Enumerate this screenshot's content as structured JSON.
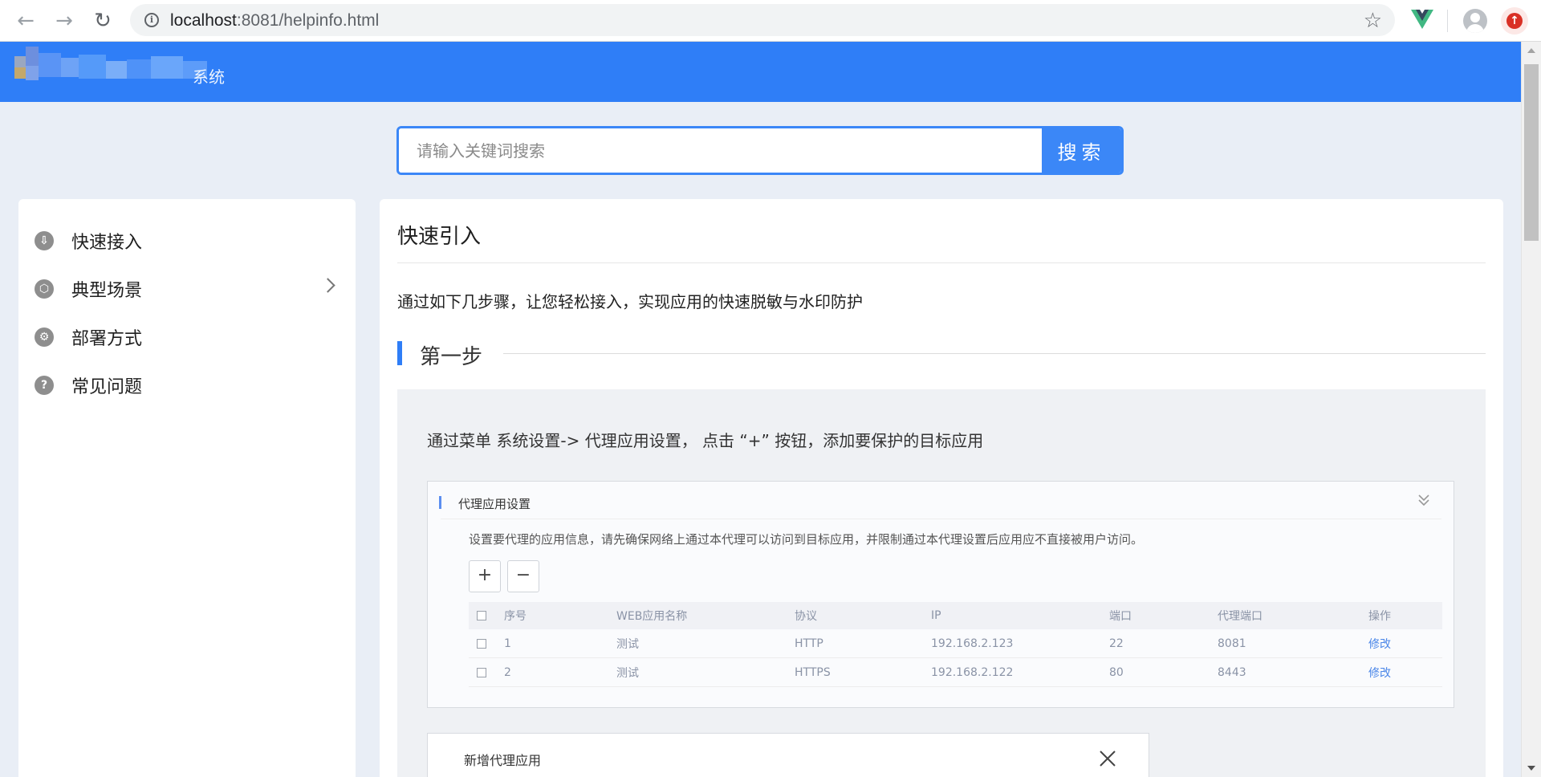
{
  "browser": {
    "url_host": "localhost",
    "url_rest": ":8081/helpinfo.html",
    "back_icon": "←",
    "forward_icon": "→",
    "reload_icon": "↻",
    "bookmark_icon": "☆",
    "update_icon": "↑"
  },
  "header": {
    "logo_text": "系统",
    "color": "#2f7ef7"
  },
  "search": {
    "placeholder": "请输入关键词搜索",
    "button_label": "搜索"
  },
  "sidebar": {
    "items": [
      {
        "label": "快速接入",
        "icon": "download-icon",
        "glyph": "⇩"
      },
      {
        "label": "典型场景",
        "icon": "hexagon-icon",
        "glyph": "⬡"
      },
      {
        "label": "部署方式",
        "icon": "wrench-icon",
        "glyph": "⚙"
      },
      {
        "label": "常见问题",
        "icon": "question-icon",
        "glyph": "?"
      }
    ]
  },
  "main": {
    "title": "快速引入",
    "intro": "通过如下几步骤，让您轻松接入，实现应用的快速脱敏与水印防护",
    "step1": {
      "title": "第一步",
      "description": "通过菜单 系统设置-> 代理应用设置， 点击 “+” 按钮，添加要保护的目标应用",
      "panel": {
        "title": "代理应用设置",
        "description": "设置要代理的应用信息，请先确保网络上通过本代理可以访问到目标应用，并限制通过本代理设置后应用应不直接被用户访问。",
        "add_label": "+",
        "remove_label": "−",
        "table": {
          "headers": [
            "序号",
            "WEB应用名称",
            "协议",
            "IP",
            "端口",
            "代理端口",
            "操作"
          ],
          "rows": [
            [
              "1",
              "测试",
              "HTTP",
              "192.168.2.123",
              "22",
              "8081",
              "修改"
            ],
            [
              "2",
              "测试",
              "HTTPS",
              "192.168.2.122",
              "80",
              "8443",
              "修改"
            ]
          ]
        }
      },
      "dialog": {
        "title": "新增代理应用"
      }
    }
  }
}
